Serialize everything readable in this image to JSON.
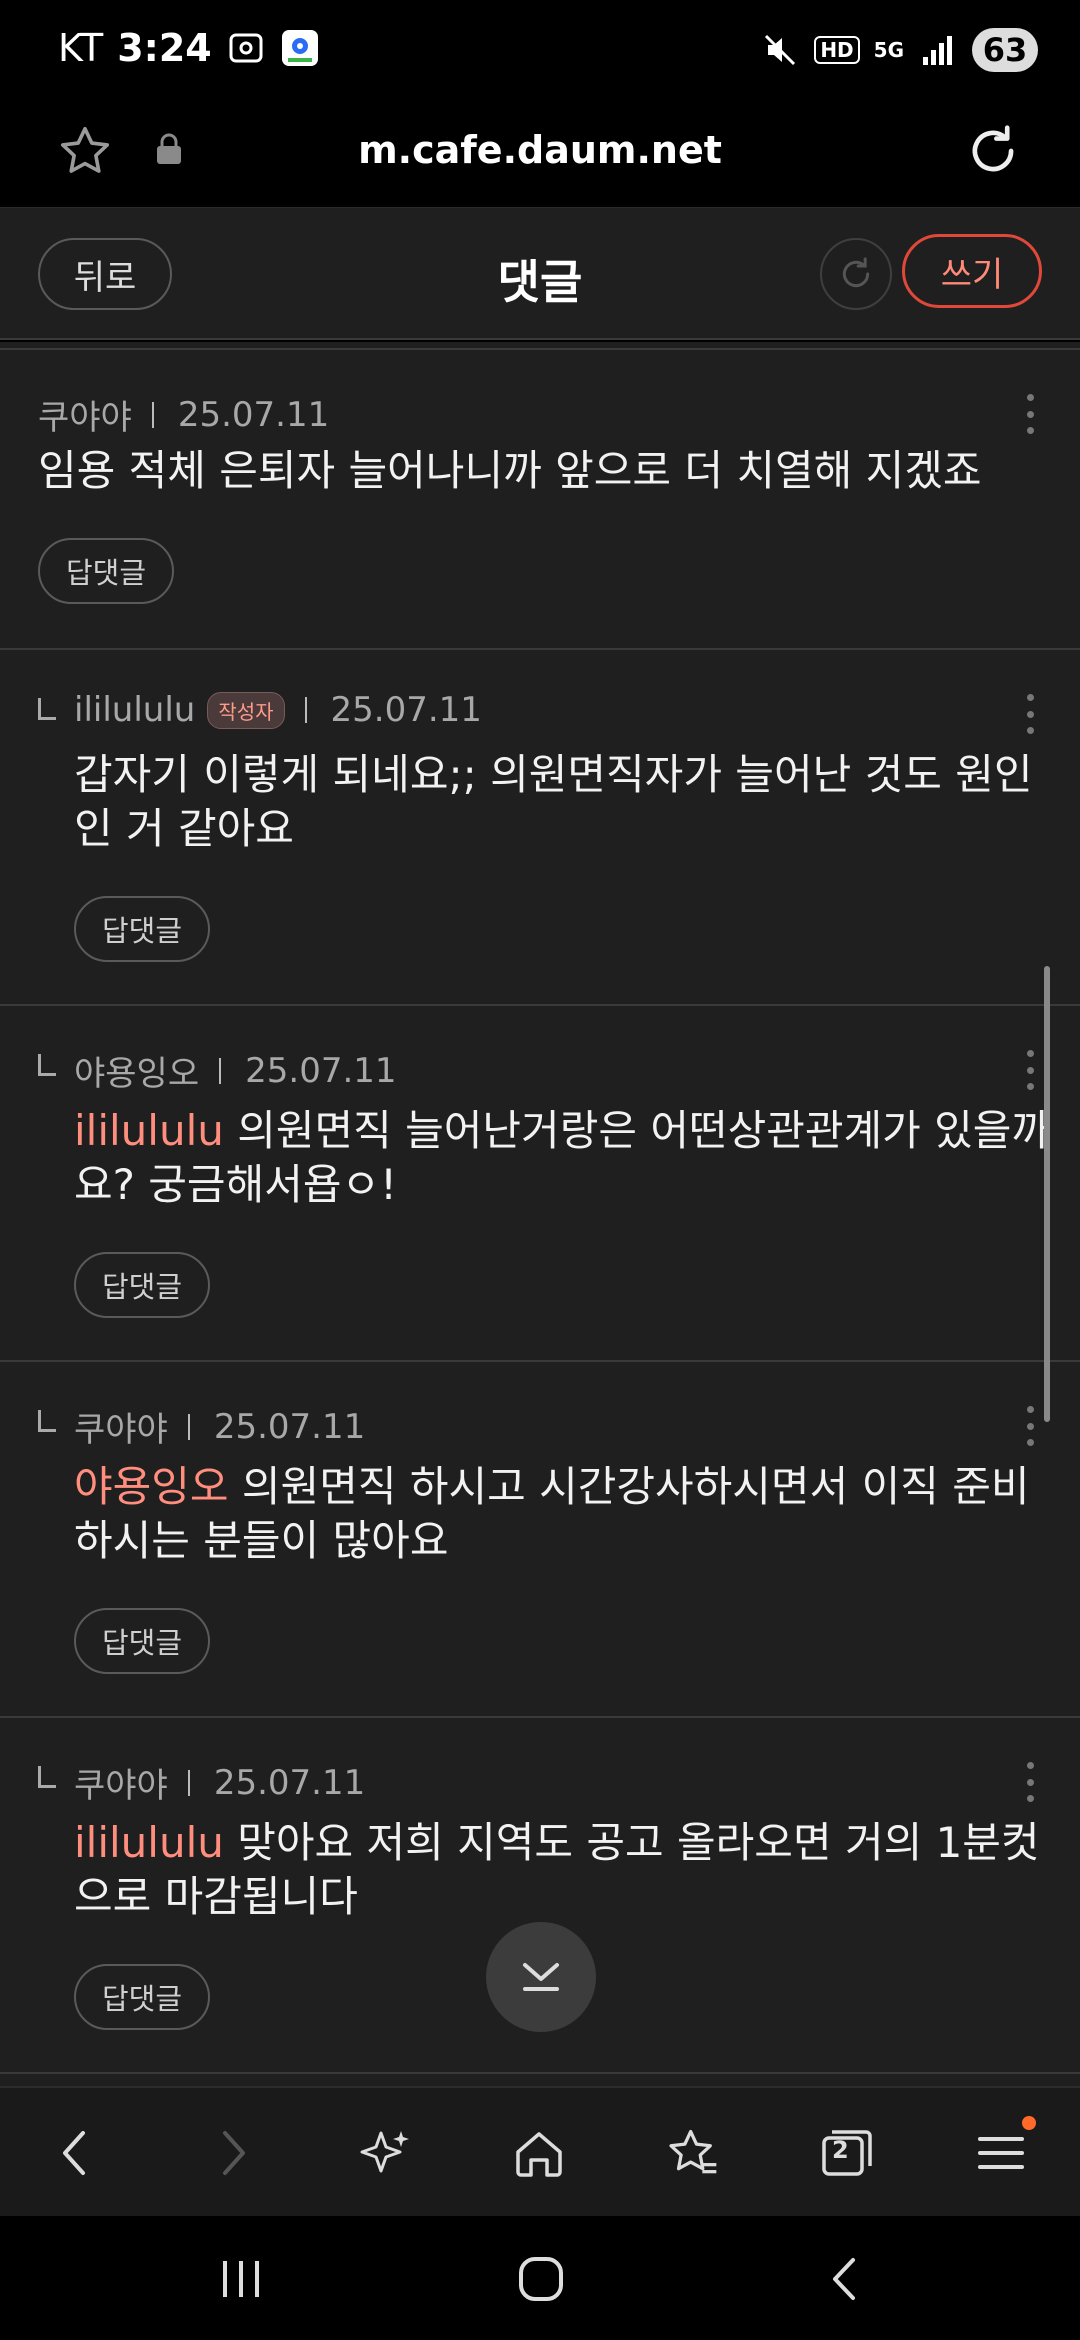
{
  "status_bar": {
    "carrier": "KT",
    "time": "3:24",
    "battery": "63",
    "hd_label": "HD",
    "network": "5G"
  },
  "browser": {
    "url": "m.cafe.daum.net"
  },
  "header": {
    "back_label": "뒤로",
    "title": "댓글",
    "write_label": "쓰기"
  },
  "comments": [
    {
      "author": "쿠야야",
      "date": "25.07.11",
      "mention": "",
      "text": "임용 적체 은퇴자 늘어나니까 앞으로 더 치열해 지겠죠",
      "reply_label": "답댓글"
    },
    {
      "author": "ililululu",
      "badge": "작성자",
      "date": "25.07.11",
      "mention": "",
      "text_line1": "갑자기 이렇게 되네요;; 의원면직자가 늘어난 것도 원인",
      "text_line2": "인 거 같아요",
      "reply_label": "답댓글"
    },
    {
      "author": "야용잉오",
      "date": "25.07.11",
      "mention": "ililululu",
      "text_line1": " 의원면직 늘어난거랑은 어떤상관관계가 있을까",
      "text_line2": "요? 궁금해서욥ㅇ!",
      "reply_label": "답댓글"
    },
    {
      "author": "쿠야야",
      "date": "25.07.11",
      "mention": "야용잉오",
      "text_line1": " 의원면직 하시고 시간강사하시면서 이직 준비",
      "text_line2": "하시는 분들이 많아요",
      "reply_label": "답댓글"
    },
    {
      "author": "쿠야야",
      "date": "25.07.11",
      "mention": "ililululu",
      "text_line1": " 맞아요 저희 지역도 공고 올라오면 거의 1분컷",
      "text_line2": "으로 마감됩니다",
      "reply_label": "답댓글"
    }
  ],
  "toolbar": {
    "tabs_count": "2"
  }
}
